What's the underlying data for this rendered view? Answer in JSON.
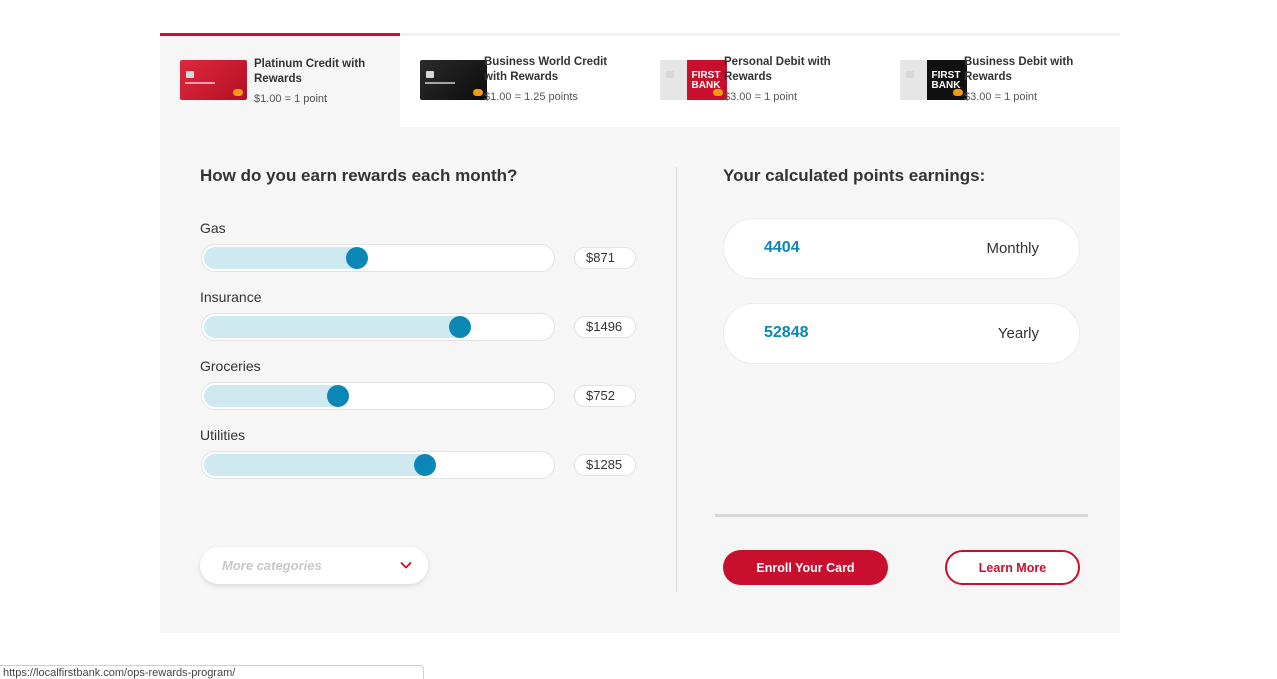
{
  "cards": [
    {
      "title": "Platinum Credit with Rewards",
      "rate": "$1.00 = 1 point",
      "brand": "",
      "active": true
    },
    {
      "title": "Business World Credit with Rewards",
      "rate": "$1.00 = 1.25 points",
      "brand": "",
      "active": false
    },
    {
      "title": "Personal Debit with Rewards",
      "rate": "$3.00 = 1 point",
      "brand": "FIRST BANK",
      "active": false
    },
    {
      "title": "Business Debit with Rewards",
      "rate": "$3.00 = 1 point",
      "brand": "FIRST BANK",
      "active": false
    }
  ],
  "calculator": {
    "title": "How do you earn rewards each month?",
    "categories": [
      {
        "label": "Gas",
        "value": "$871",
        "fraction": 0.44
      },
      {
        "label": "Insurance",
        "value": "$1496",
        "fraction": 0.735
      },
      {
        "label": "Groceries",
        "value": "$752",
        "fraction": 0.385
      },
      {
        "label": "Utilities",
        "value": "$1285",
        "fraction": 0.635
      }
    ],
    "more_placeholder": "More categories"
  },
  "results": {
    "title": "Your calculated points earnings:",
    "monthly_value": "4404",
    "monthly_label": "Monthly",
    "yearly_value": "52848",
    "yearly_label": "Yearly"
  },
  "actions": {
    "enroll_label": "Enroll Your Card",
    "learn_label": "Learn More"
  },
  "status_bar": {
    "url": "https://localfirstbank.com/ops-rewards-program/"
  },
  "colors": {
    "brand_red": "#c8102e",
    "slider_blue": "#0a87b5",
    "slider_fill": "#cfe9f1"
  },
  "icons": {
    "dropdown": "chevron-down-icon"
  }
}
